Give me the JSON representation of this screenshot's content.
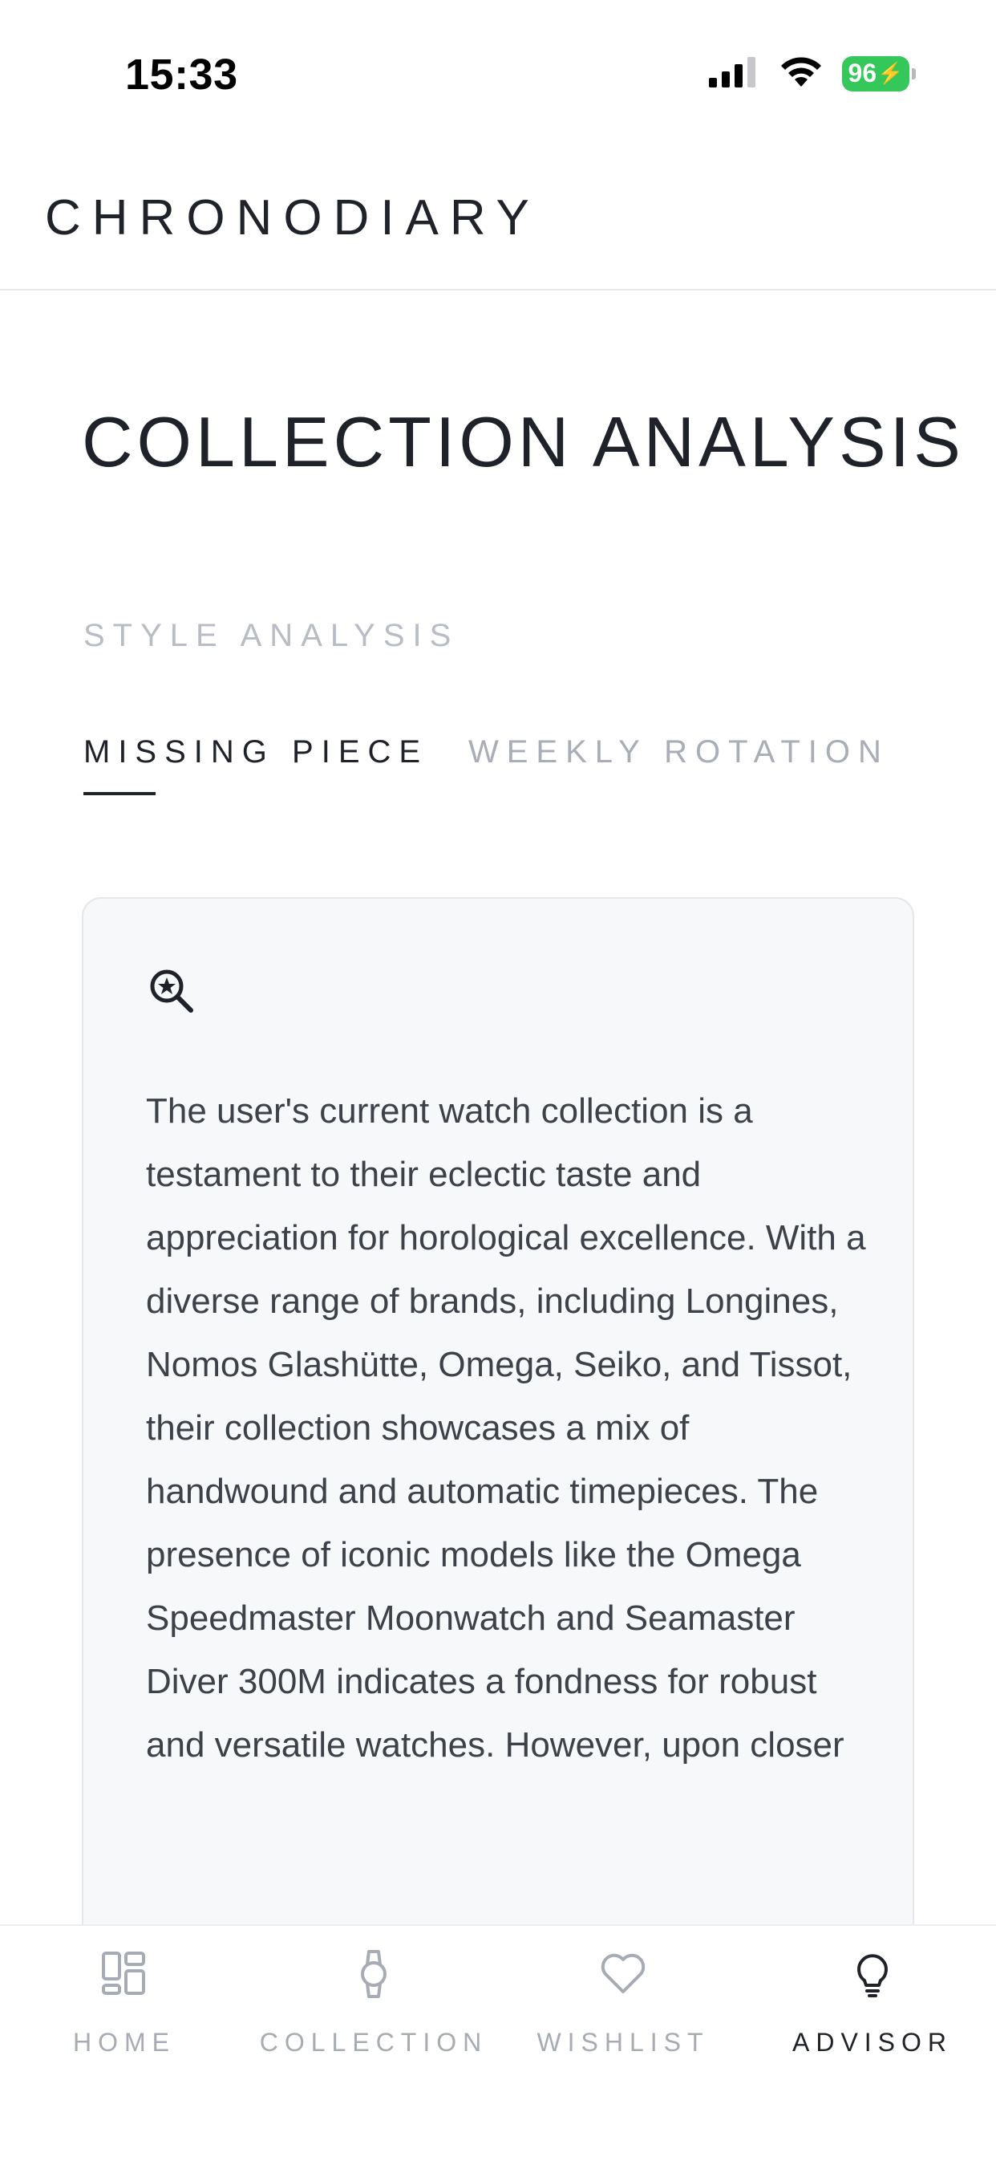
{
  "status_bar": {
    "time": "15:33",
    "battery": "96"
  },
  "header": {
    "brand": "CHRONODIARY"
  },
  "page": {
    "title": "COLLECTION ANALYSIS",
    "section_label": "STYLE ANALYSIS"
  },
  "tabs": [
    {
      "label": "MISSING PIECE",
      "active": true
    },
    {
      "label": "WEEKLY ROTATION",
      "active": false
    }
  ],
  "card": {
    "icon": "magnifier-star-icon",
    "text": "The user's current watch collection is a testament to their eclectic taste and appreciation for horological excellence. With a diverse range of brands, including Longines, Nomos Glashütte, Omega, Seiko, and Tissot, their collection showcases a mix of handwound and automatic timepieces. The presence of iconic models like the Omega Speedmaster Moonwatch and Seamaster Diver 300M indicates a fondness for robust and versatile watches. However, upon closer"
  },
  "nav": {
    "items": [
      {
        "label": "HOME",
        "icon": "grid-icon",
        "active": false
      },
      {
        "label": "COLLECTION",
        "icon": "watch-icon",
        "active": false
      },
      {
        "label": "WISHLIST",
        "icon": "heart-icon",
        "active": false
      },
      {
        "label": "ADVISOR",
        "icon": "lightbulb-icon",
        "active": true
      }
    ]
  },
  "colors": {
    "text": "#1f2329",
    "muted": "#a9adb6",
    "battery": "#34c759",
    "card_bg": "#f7f8fa"
  }
}
